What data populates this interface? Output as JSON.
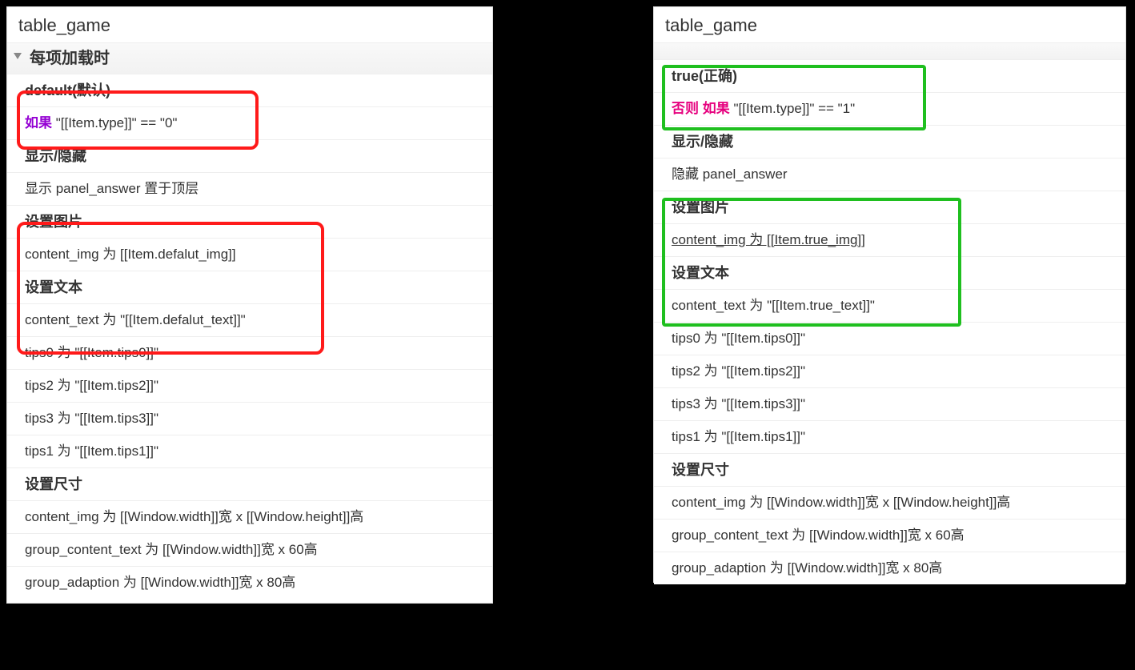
{
  "left": {
    "title": "table_game",
    "sectionHeader": "每项加载时",
    "condition": {
      "name": "default(默认)",
      "keyword": "如果",
      "expr": "\"[[Item.type]]\" == \"0\""
    },
    "showHide": {
      "cat": "显示/隐藏",
      "line": "显示 panel_answer  置于顶层"
    },
    "setImage": {
      "cat": "设置图片",
      "line": "content_img 为 [[Item.defalut_img]]"
    },
    "setText": {
      "cat": "设置文本",
      "line": "content_text 为 \"[[Item.defalut_text]]\""
    },
    "tips": [
      "tips0 为 \"[[Item.tips0]]\"",
      "tips2 为 \"[[Item.tips2]]\"",
      "tips3 为 \"[[Item.tips3]]\"",
      "tips1 为 \"[[Item.tips1]]\""
    ],
    "setSize": {
      "cat": "设置尺寸",
      "lines": [
        "content_img 为 [[Window.width]]宽 x [[Window.height]]高",
        "group_content_text 为 [[Window.width]]宽 x 60高",
        "group_adaption 为 [[Window.width]]宽 x 80高"
      ]
    }
  },
  "right": {
    "title": "table_game",
    "condition": {
      "name": "true(正确)",
      "keyword": "否则 如果",
      "expr": "\"[[Item.type]]\" == \"1\""
    },
    "showHide": {
      "cat": "显示/隐藏",
      "line": "隐藏 panel_answer"
    },
    "setImage": {
      "cat": "设置图片",
      "line": "content_img 为 [[Item.true_img]]"
    },
    "setText": {
      "cat": "设置文本",
      "line": "content_text 为 \"[[Item.true_text]]\""
    },
    "tips": [
      "tips0 为 \"[[Item.tips0]]\"",
      "tips2 为 \"[[Item.tips2]]\"",
      "tips3 为 \"[[Item.tips3]]\"",
      "tips1 为 \"[[Item.tips1]]\""
    ],
    "setSize": {
      "cat": "设置尺寸",
      "lines": [
        "content_img 为 [[Window.width]]宽 x [[Window.height]]高",
        "group_content_text 为 [[Window.width]]宽 x 60高",
        "group_adaption 为 [[Window.width]]宽 x 80高"
      ]
    }
  }
}
